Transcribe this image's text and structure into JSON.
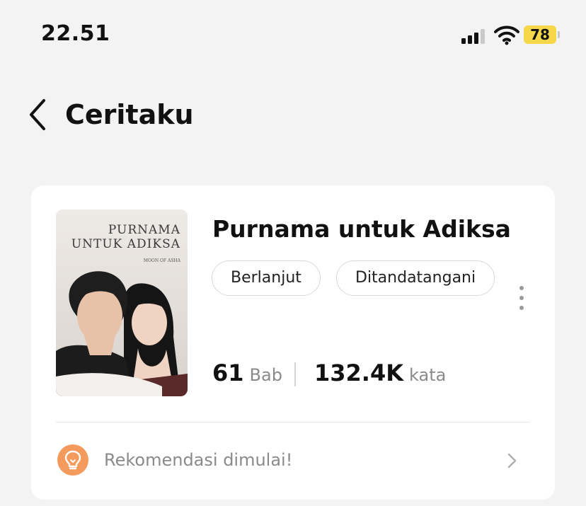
{
  "status_bar": {
    "time": "22.51",
    "battery_level": "78",
    "battery_color": "#f6d74a"
  },
  "nav": {
    "back_icon": "chevron-left-icon",
    "title": "Ceritaku"
  },
  "story": {
    "cover_title_line1": "PURNAMA",
    "cover_title_line2": "UNTUK ADIKSA",
    "cover_author": "MOON OF ASHA",
    "title": "Purnama untuk Adiksa",
    "tags": [
      "Berlanjut",
      "Ditandatangani"
    ],
    "chapters_count": "61",
    "chapters_unit": "Bab",
    "words_count": "132.4K",
    "words_unit": "kata",
    "more_icon": "more-vertical-icon"
  },
  "recommendation": {
    "icon": "lightbulb-icon",
    "icon_color": "#f39a5c",
    "label": "Rekomendasi dimulai!",
    "chevron_icon": "chevron-right-icon"
  }
}
